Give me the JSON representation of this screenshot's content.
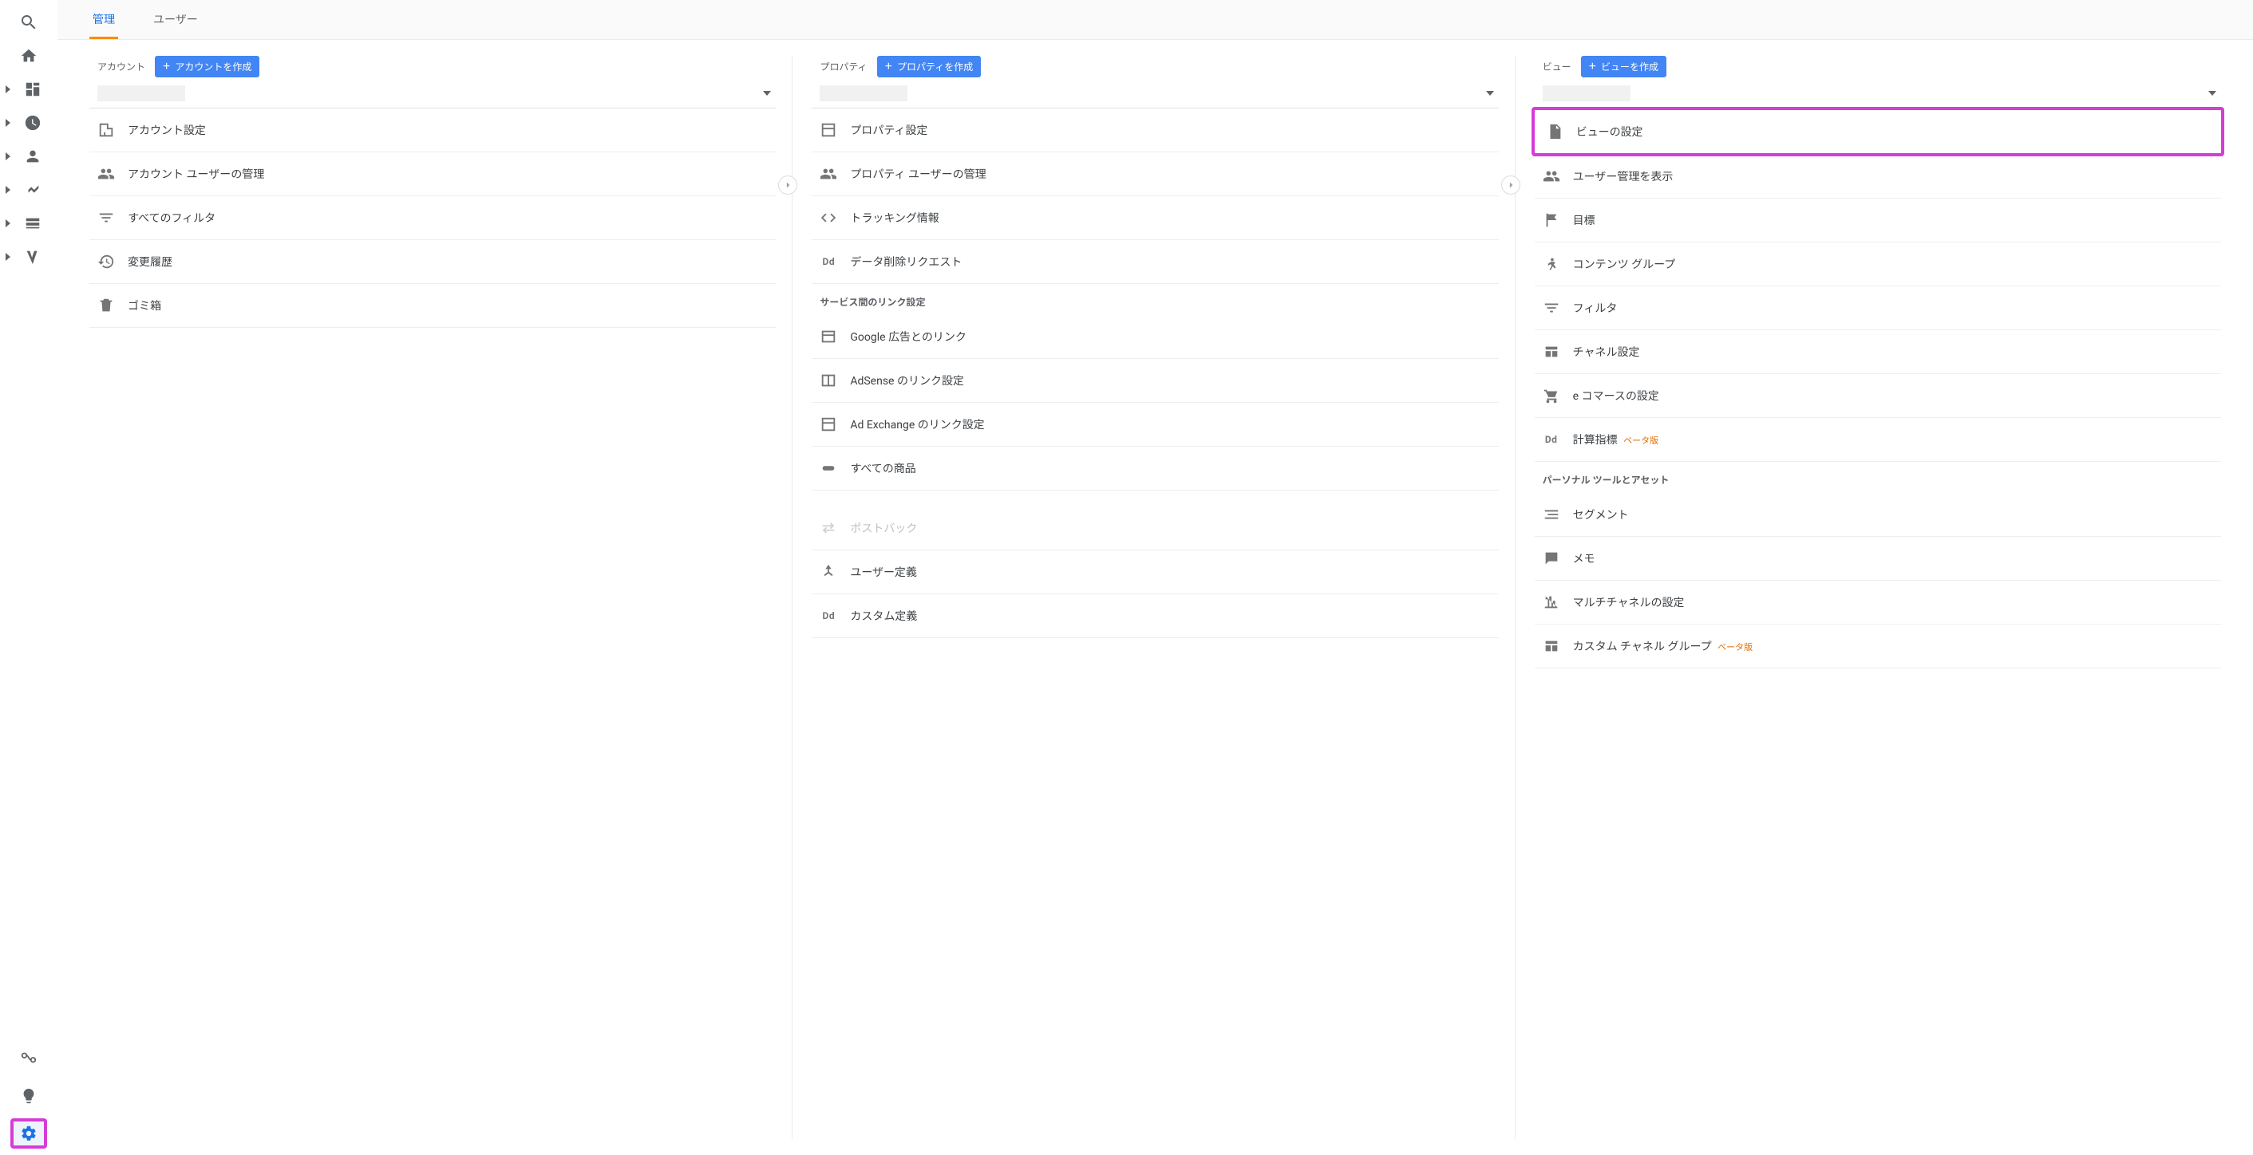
{
  "tabs": {
    "admin": "管理",
    "user": "ユーザー"
  },
  "account": {
    "label": "アカウント",
    "create": "アカウントを作成",
    "items": {
      "settings": "アカウント設定",
      "users": "アカウント ユーザーの管理",
      "filters": "すべてのフィルタ",
      "history": "変更履歴",
      "trash": "ゴミ箱"
    }
  },
  "property": {
    "label": "プロパティ",
    "create": "プロパティを作成",
    "items": {
      "settings": "プロパティ設定",
      "users": "プロパティ ユーザーの管理",
      "tracking": "トラッキング情報",
      "dataDeletion": "データ削除リクエスト"
    },
    "linkSection": "サービス間のリンク設定",
    "links": {
      "ads": "Google 広告とのリンク",
      "adsense": "AdSense のリンク設定",
      "adexchange": "Ad Exchange のリンク設定",
      "allProducts": "すべての商品"
    },
    "extra": {
      "postback": "ポストバック",
      "userDef": "ユーザー定義",
      "customDef": "カスタム定義"
    }
  },
  "view": {
    "label": "ビュー",
    "create": "ビューを作成",
    "items": {
      "settings": "ビューの設定",
      "users": "ユーザー管理を表示",
      "goals": "目標",
      "contentGroups": "コンテンツ グループ",
      "filters": "フィルタ",
      "channel": "チャネル設定",
      "ecommerce": "e コマースの設定",
      "calcMetrics": "計算指標",
      "beta": "ベータ版"
    },
    "personalSection": "パーソナル ツールとアセット",
    "personal": {
      "segments": "セグメント",
      "memo": "メモ",
      "multiChannel": "マルチチャネルの設定",
      "customChannelGroup": "カスタム チャネル グループ",
      "beta": "ベータ版"
    }
  }
}
